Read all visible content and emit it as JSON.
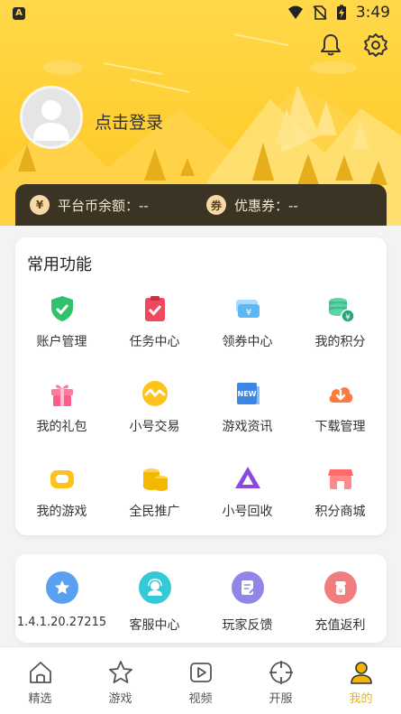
{
  "status_bar": {
    "time": "3:49",
    "app_badge": "A"
  },
  "user": {
    "login_text": "点击登录"
  },
  "balance": {
    "coin_symbol": "¥",
    "coin_label": "平台币余额：--",
    "coupon_symbol": "券",
    "coupon_label": "优惠券：--"
  },
  "functions": {
    "title": "常用功能",
    "items": [
      {
        "label": "账户管理",
        "icon": "shield-check-icon"
      },
      {
        "label": "任务中心",
        "icon": "clipboard-check-icon"
      },
      {
        "label": "领券中心",
        "icon": "coupon-ticket-icon"
      },
      {
        "label": "我的积分",
        "icon": "coins-stack-icon"
      },
      {
        "label": "我的礼包",
        "icon": "gift-icon"
      },
      {
        "label": "小号交易",
        "icon": "exchange-icon"
      },
      {
        "label": "游戏资讯",
        "icon": "news-icon"
      },
      {
        "label": "下载管理",
        "icon": "cloud-download-icon"
      },
      {
        "label": "我的游戏",
        "icon": "gamepad-icon"
      },
      {
        "label": "全民推广",
        "icon": "coins-icon"
      },
      {
        "label": "小号回收",
        "icon": "recycle-triangle-icon"
      },
      {
        "label": "积分商城",
        "icon": "store-icon"
      }
    ]
  },
  "misc": {
    "items": [
      {
        "label": "1.4.1.20.27215",
        "icon": "star-icon",
        "color": "#5aa0f0"
      },
      {
        "label": "客服中心",
        "icon": "customer-service-icon",
        "color": "#33c9d6"
      },
      {
        "label": "玩家反馈",
        "icon": "feedback-icon",
        "color": "#8f86e8"
      },
      {
        "label": "充值返利",
        "icon": "recharge-icon",
        "color": "#f07e7e"
      }
    ]
  },
  "tabs": [
    {
      "label": "精选",
      "icon": "home-icon",
      "active": false
    },
    {
      "label": "游戏",
      "icon": "star-outline-icon",
      "active": false
    },
    {
      "label": "视频",
      "icon": "video-icon",
      "active": false
    },
    {
      "label": "开服",
      "icon": "crosshair-icon",
      "active": false
    },
    {
      "label": "我的",
      "icon": "user-icon",
      "active": true
    }
  ],
  "colors": {
    "accent": "#f5b400",
    "header": "#ffd03a",
    "balance_bar": "#3b3324"
  }
}
